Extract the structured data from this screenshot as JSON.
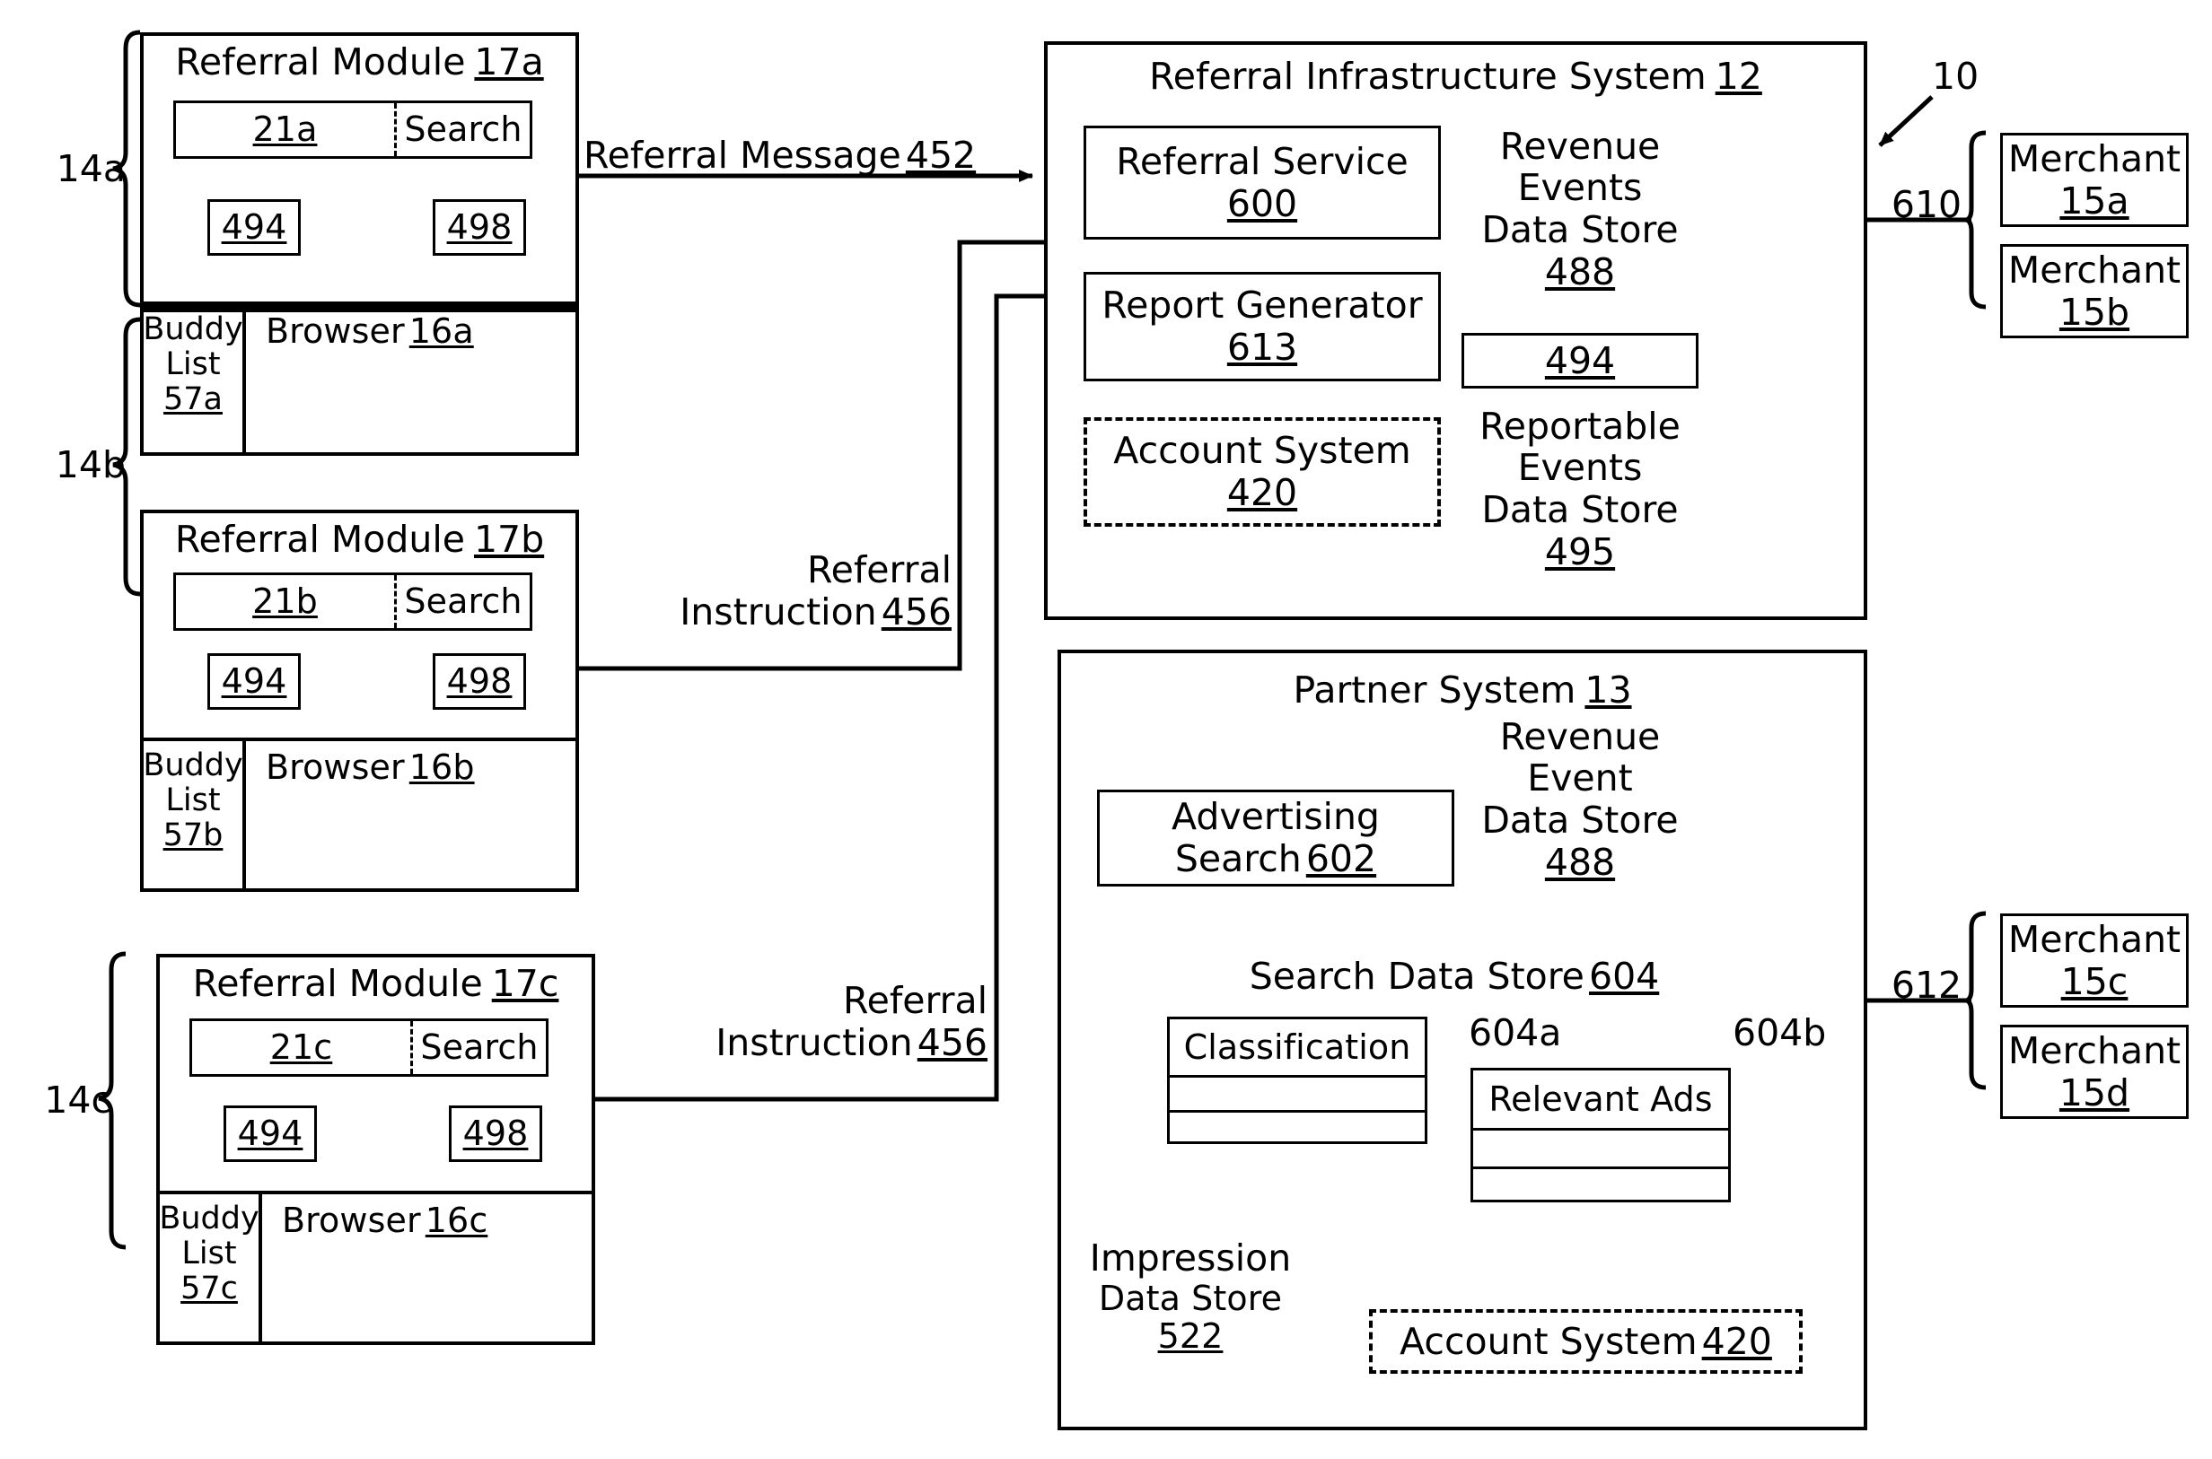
{
  "figure": {
    "ref_label": "10"
  },
  "clients": [
    {
      "bracket_label": "14a",
      "module_title": "Referral Module",
      "module_ref": "17a",
      "field_ref": "21a",
      "search_label": "Search",
      "box_left_ref": "494",
      "box_right_ref": "498",
      "buddy_line1": "Buddy",
      "buddy_line2": "List",
      "buddy_ref": "57a",
      "browser_label": "Browser",
      "browser_ref": "16a"
    },
    {
      "bracket_label": "14b",
      "module_title": "Referral Module",
      "module_ref": "17b",
      "field_ref": "21b",
      "search_label": "Search",
      "box_left_ref": "494",
      "box_right_ref": "498",
      "buddy_line1": "Buddy",
      "buddy_line2": "List",
      "buddy_ref": "57b",
      "browser_label": "Browser",
      "browser_ref": "16b"
    },
    {
      "bracket_label": "14c",
      "module_title": "Referral Module",
      "module_ref": "17c",
      "field_ref": "21c",
      "search_label": "Search",
      "box_left_ref": "494",
      "box_right_ref": "498",
      "buddy_line1": "Buddy",
      "buddy_line2": "List",
      "buddy_ref": "57c",
      "browser_label": "Browser",
      "browser_ref": "16c"
    }
  ],
  "flows": {
    "referral_message_line1": "Referral Message",
    "referral_message_ref": "452",
    "referral_instruction_b_line1": "Referral",
    "referral_instruction_b_line2": "Instruction",
    "referral_instruction_b_ref": "456",
    "referral_instruction_c_line1": "Referral",
    "referral_instruction_c_line2": "Instruction",
    "referral_instruction_c_ref": "456"
  },
  "infrastructure": {
    "title": "Referral Infrastructure System",
    "title_ref": "12",
    "referral_service": {
      "label": "Referral Service",
      "ref": "600"
    },
    "report_generator": {
      "label": "Report Generator",
      "ref": "613"
    },
    "account_system": {
      "label": "Account System",
      "ref": "420"
    },
    "revenue_events": {
      "line1": "Revenue Events",
      "line2": "Data Store",
      "ref": "488"
    },
    "plain_ref_box": {
      "ref": "494"
    },
    "reportable_events": {
      "line1": "Reportable Events",
      "line2": "Data Store",
      "ref": "495"
    }
  },
  "partner": {
    "title": "Partner System",
    "title_ref": "13",
    "advertising_search": {
      "line1": "Advertising",
      "line2": "Search",
      "ref": "602"
    },
    "revenue_event": {
      "line1": "Revenue Event",
      "line2": "Data Store",
      "ref": "488"
    },
    "search_data_store": {
      "label": "Search Data Store",
      "ref": "604"
    },
    "classification": {
      "label": "Classification",
      "ref": "604a"
    },
    "relevant_ads": {
      "label": "Relevant Ads",
      "ref": "604b"
    },
    "impression_data_store": {
      "line1": "Impression",
      "line2": "Data Store",
      "ref": "522"
    },
    "account_system": {
      "label": "Account System",
      "ref": "420"
    }
  },
  "merchants_top": {
    "connector_ref": "610",
    "items": [
      {
        "label": "Merchant",
        "ref": "15a"
      },
      {
        "label": "Merchant",
        "ref": "15b"
      }
    ]
  },
  "merchants_bottom": {
    "connector_ref": "612",
    "items": [
      {
        "label": "Merchant",
        "ref": "15c"
      },
      {
        "label": "Merchant",
        "ref": "15d"
      }
    ]
  }
}
